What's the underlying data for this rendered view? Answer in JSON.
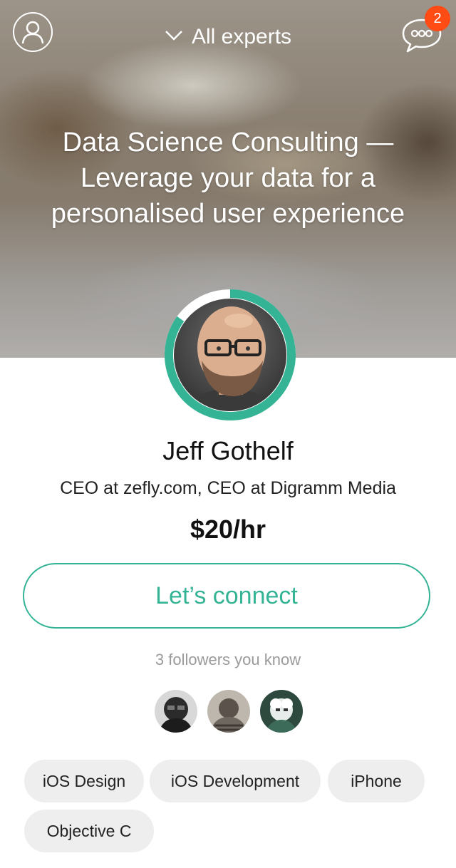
{
  "header": {
    "title": "All experts",
    "notification_count": "2",
    "icons": {
      "profile": "user-icon",
      "messages": "chat-bubble-icon",
      "dropdown": "chevron-down-icon"
    }
  },
  "hero": {
    "title": "Data Science Consulting — Leverage your data for a personalised user experience"
  },
  "expert": {
    "name": "Jeff Gothelf",
    "role": "CEO at zefly.com, CEO at Digramm Media",
    "rate": "$20/hr",
    "availability_fraction": 0.85
  },
  "connect": {
    "label": "Let’s connect"
  },
  "followers": {
    "label": "3 followers you know",
    "count": 3
  },
  "tags": [
    "iOS Design",
    "iOS Development",
    "iPhone",
    "Objective C"
  ],
  "colors": {
    "accent": "#35b495",
    "badge": "#ff4b14",
    "tag_bg": "#eeeeee"
  }
}
